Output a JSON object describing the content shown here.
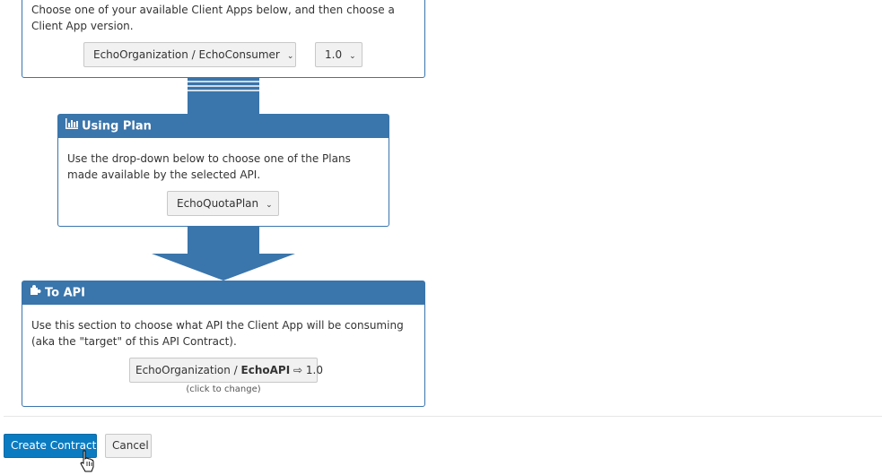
{
  "client_app_section": {
    "description": "Choose one of your available Client Apps below, and then choose a Client App version.",
    "app_select_value": "EchoOrganization / EchoConsumer",
    "version_select_value": "1.0"
  },
  "plan_section": {
    "title": "Using Plan",
    "icon": "bar-chart-icon",
    "description": "Use the drop-down below to choose one of the Plans made available by the selected API.",
    "plan_select_value": "EchoQuotaPlan"
  },
  "api_section": {
    "title": "To API",
    "icon": "puzzle-icon",
    "description": "Use this section to choose what API the Client App will be consuming (aka the \"target\" of this API Contract).",
    "api_org": "EchoOrganization / ",
    "api_name": "EchoAPI",
    "api_arrow": "⇨",
    "api_version": "1.0",
    "click_hint": "(click to change)"
  },
  "actions": {
    "create_label": "Create Contract",
    "cancel_label": "Cancel"
  },
  "colors": {
    "accent": "#3a75ab",
    "primary_button": "#0a7bc1"
  }
}
